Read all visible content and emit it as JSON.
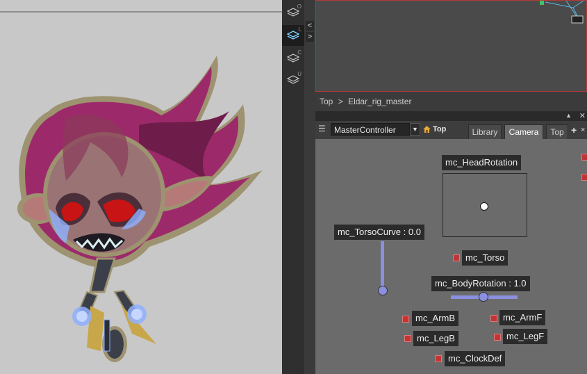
{
  "layers": [
    {
      "letter": "O"
    },
    {
      "letter": "L"
    },
    {
      "letter": "C"
    },
    {
      "letter": "U"
    }
  ],
  "nav": {
    "collapse": "<",
    "expand": ">"
  },
  "breadcrumb": {
    "root": "Top",
    "separator": ">",
    "current": "Eldar_rig_master"
  },
  "toolbar": {
    "menu_icon": "hamburger-icon",
    "controller_value": "MasterController",
    "dropdown_arrow": "▼",
    "top_label": "Top",
    "tabs": [
      {
        "label": "Library",
        "active": false
      },
      {
        "label": "Camera",
        "active": true
      },
      {
        "label": "Top",
        "active": false
      }
    ],
    "add": "+",
    "close": "×"
  },
  "controllers": {
    "head_rotation": "mc_HeadRotation",
    "torso_curve": "mc_TorsoCurve : 0.0",
    "torso_curve_value": 0.0,
    "torso": "mc_Torso",
    "body_rotation": "mc_BodyRotation : 1.0",
    "body_rotation_value": 1.0,
    "arm_b": "mc_ArmB",
    "arm_f": "mc_ArmF",
    "leg_b": "mc_LegB",
    "leg_f": "mc_LegF",
    "clock_def": "mc_ClockDef"
  },
  "colors": {
    "accent_red": "#c23535",
    "slider_blue": "#8b8fe0",
    "viewer_border": "#b53939",
    "hair": "#9c2a6a",
    "outline": "#9e9370"
  }
}
